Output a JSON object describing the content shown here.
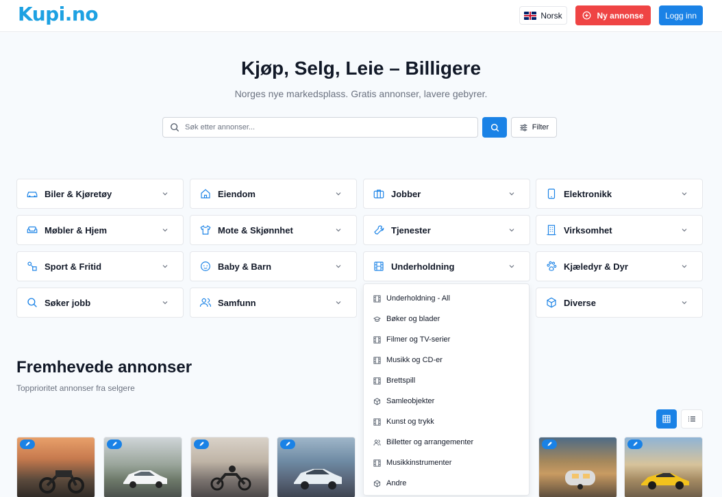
{
  "header": {
    "logo": "Kupi.no",
    "language_label": "Norsk",
    "new_listing_label": "Ny annonse",
    "login_label": "Logg inn"
  },
  "hero": {
    "title": "Kjøp, Selg, Leie – Billigere",
    "subtitle": "Norges nye markedsplass. Gratis annonser, lavere gebyrer.",
    "search_placeholder": "Søk etter annonser...",
    "filter_label": "Filter"
  },
  "categories": [
    {
      "label": "Biler & Kjøretøy",
      "icon": "car-icon"
    },
    {
      "label": "Eiendom",
      "icon": "home-icon"
    },
    {
      "label": "Jobber",
      "icon": "briefcase-icon"
    },
    {
      "label": "Elektronikk",
      "icon": "phone-icon"
    },
    {
      "label": "Møbler & Hjem",
      "icon": "sofa-icon"
    },
    {
      "label": "Mote & Skjønnhet",
      "icon": "shirt-icon"
    },
    {
      "label": "Tjenester",
      "icon": "wrench-icon"
    },
    {
      "label": "Virksomhet",
      "icon": "building-icon"
    },
    {
      "label": "Sport & Fritid",
      "icon": "sport-icon"
    },
    {
      "label": "Baby & Barn",
      "icon": "baby-icon"
    },
    {
      "label": "Underholdning",
      "icon": "film-icon"
    },
    {
      "label": "Kjæledyr & Dyr",
      "icon": "paw-icon"
    },
    {
      "label": "Søker jobb",
      "icon": "search-icon"
    },
    {
      "label": "Samfunn",
      "icon": "users-icon"
    },
    {
      "label": "",
      "icon": ""
    },
    {
      "label": "Diverse",
      "icon": "box-icon"
    }
  ],
  "dropdown": {
    "items": [
      {
        "label": "Underholdning - All",
        "icon": "film-icon"
      },
      {
        "label": "Bøker og blader",
        "icon": "graduation-cap-icon"
      },
      {
        "label": "Filmer og TV-serier",
        "icon": "film-icon"
      },
      {
        "label": "Musikk og CD-er",
        "icon": "film-icon"
      },
      {
        "label": "Brettspill",
        "icon": "film-icon"
      },
      {
        "label": "Samleobjekter",
        "icon": "box-icon"
      },
      {
        "label": "Kunst og trykk",
        "icon": "film-icon"
      },
      {
        "label": "Billetter og arrangementer",
        "icon": "users-icon"
      },
      {
        "label": "Musikkinstrumenter",
        "icon": "film-icon"
      },
      {
        "label": "Andre",
        "icon": "box-icon"
      }
    ]
  },
  "featured": {
    "title": "Fremhevede annonser",
    "subtitle": "Topprioritet annonser fra selgere"
  },
  "colors": {
    "brand": "#1da1e2",
    "primary": "#1a82e6",
    "danger": "#ef4444"
  }
}
